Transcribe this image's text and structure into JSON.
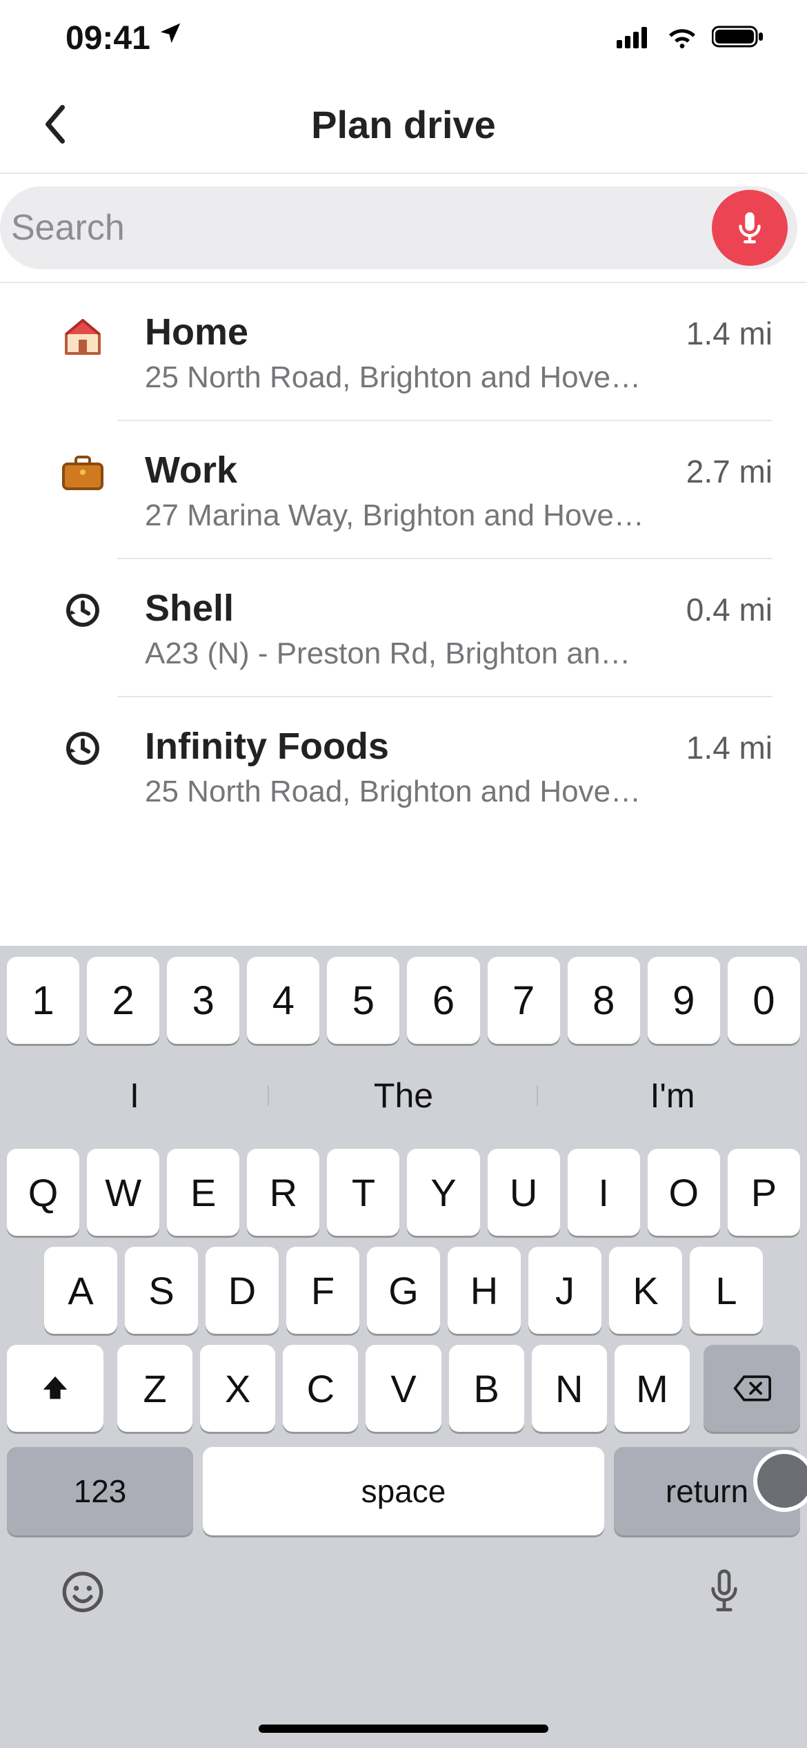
{
  "status": {
    "time": "09:41"
  },
  "header": {
    "title": "Plan drive"
  },
  "search": {
    "placeholder": "Search",
    "value": ""
  },
  "results": [
    {
      "icon": "home",
      "title": "Home",
      "subtitle": "25 North Road, Brighton and Hove…",
      "distance": "1.4 mi"
    },
    {
      "icon": "work",
      "title": "Work",
      "subtitle": "27 Marina Way, Brighton and Hove…",
      "distance": "2.7 mi"
    },
    {
      "icon": "history",
      "title": "Shell",
      "subtitle": "A23 (N) - Preston Rd, Brighton an…",
      "distance": "0.4 mi"
    },
    {
      "icon": "history",
      "title": "Infinity Foods",
      "subtitle": "25 North Road, Brighton and Hove…",
      "distance": "1.4 mi"
    }
  ],
  "keyboard": {
    "numbers": [
      "1",
      "2",
      "3",
      "4",
      "5",
      "6",
      "7",
      "8",
      "9",
      "0"
    ],
    "suggestions": [
      "I",
      "The",
      "I'm"
    ],
    "row1": [
      "Q",
      "W",
      "E",
      "R",
      "T",
      "Y",
      "U",
      "I",
      "O",
      "P"
    ],
    "row2": [
      "A",
      "S",
      "D",
      "F",
      "G",
      "H",
      "J",
      "K",
      "L"
    ],
    "row3": [
      "Z",
      "X",
      "C",
      "V",
      "B",
      "N",
      "M"
    ],
    "numSwitch": "123",
    "space": "space",
    "return": "return"
  }
}
